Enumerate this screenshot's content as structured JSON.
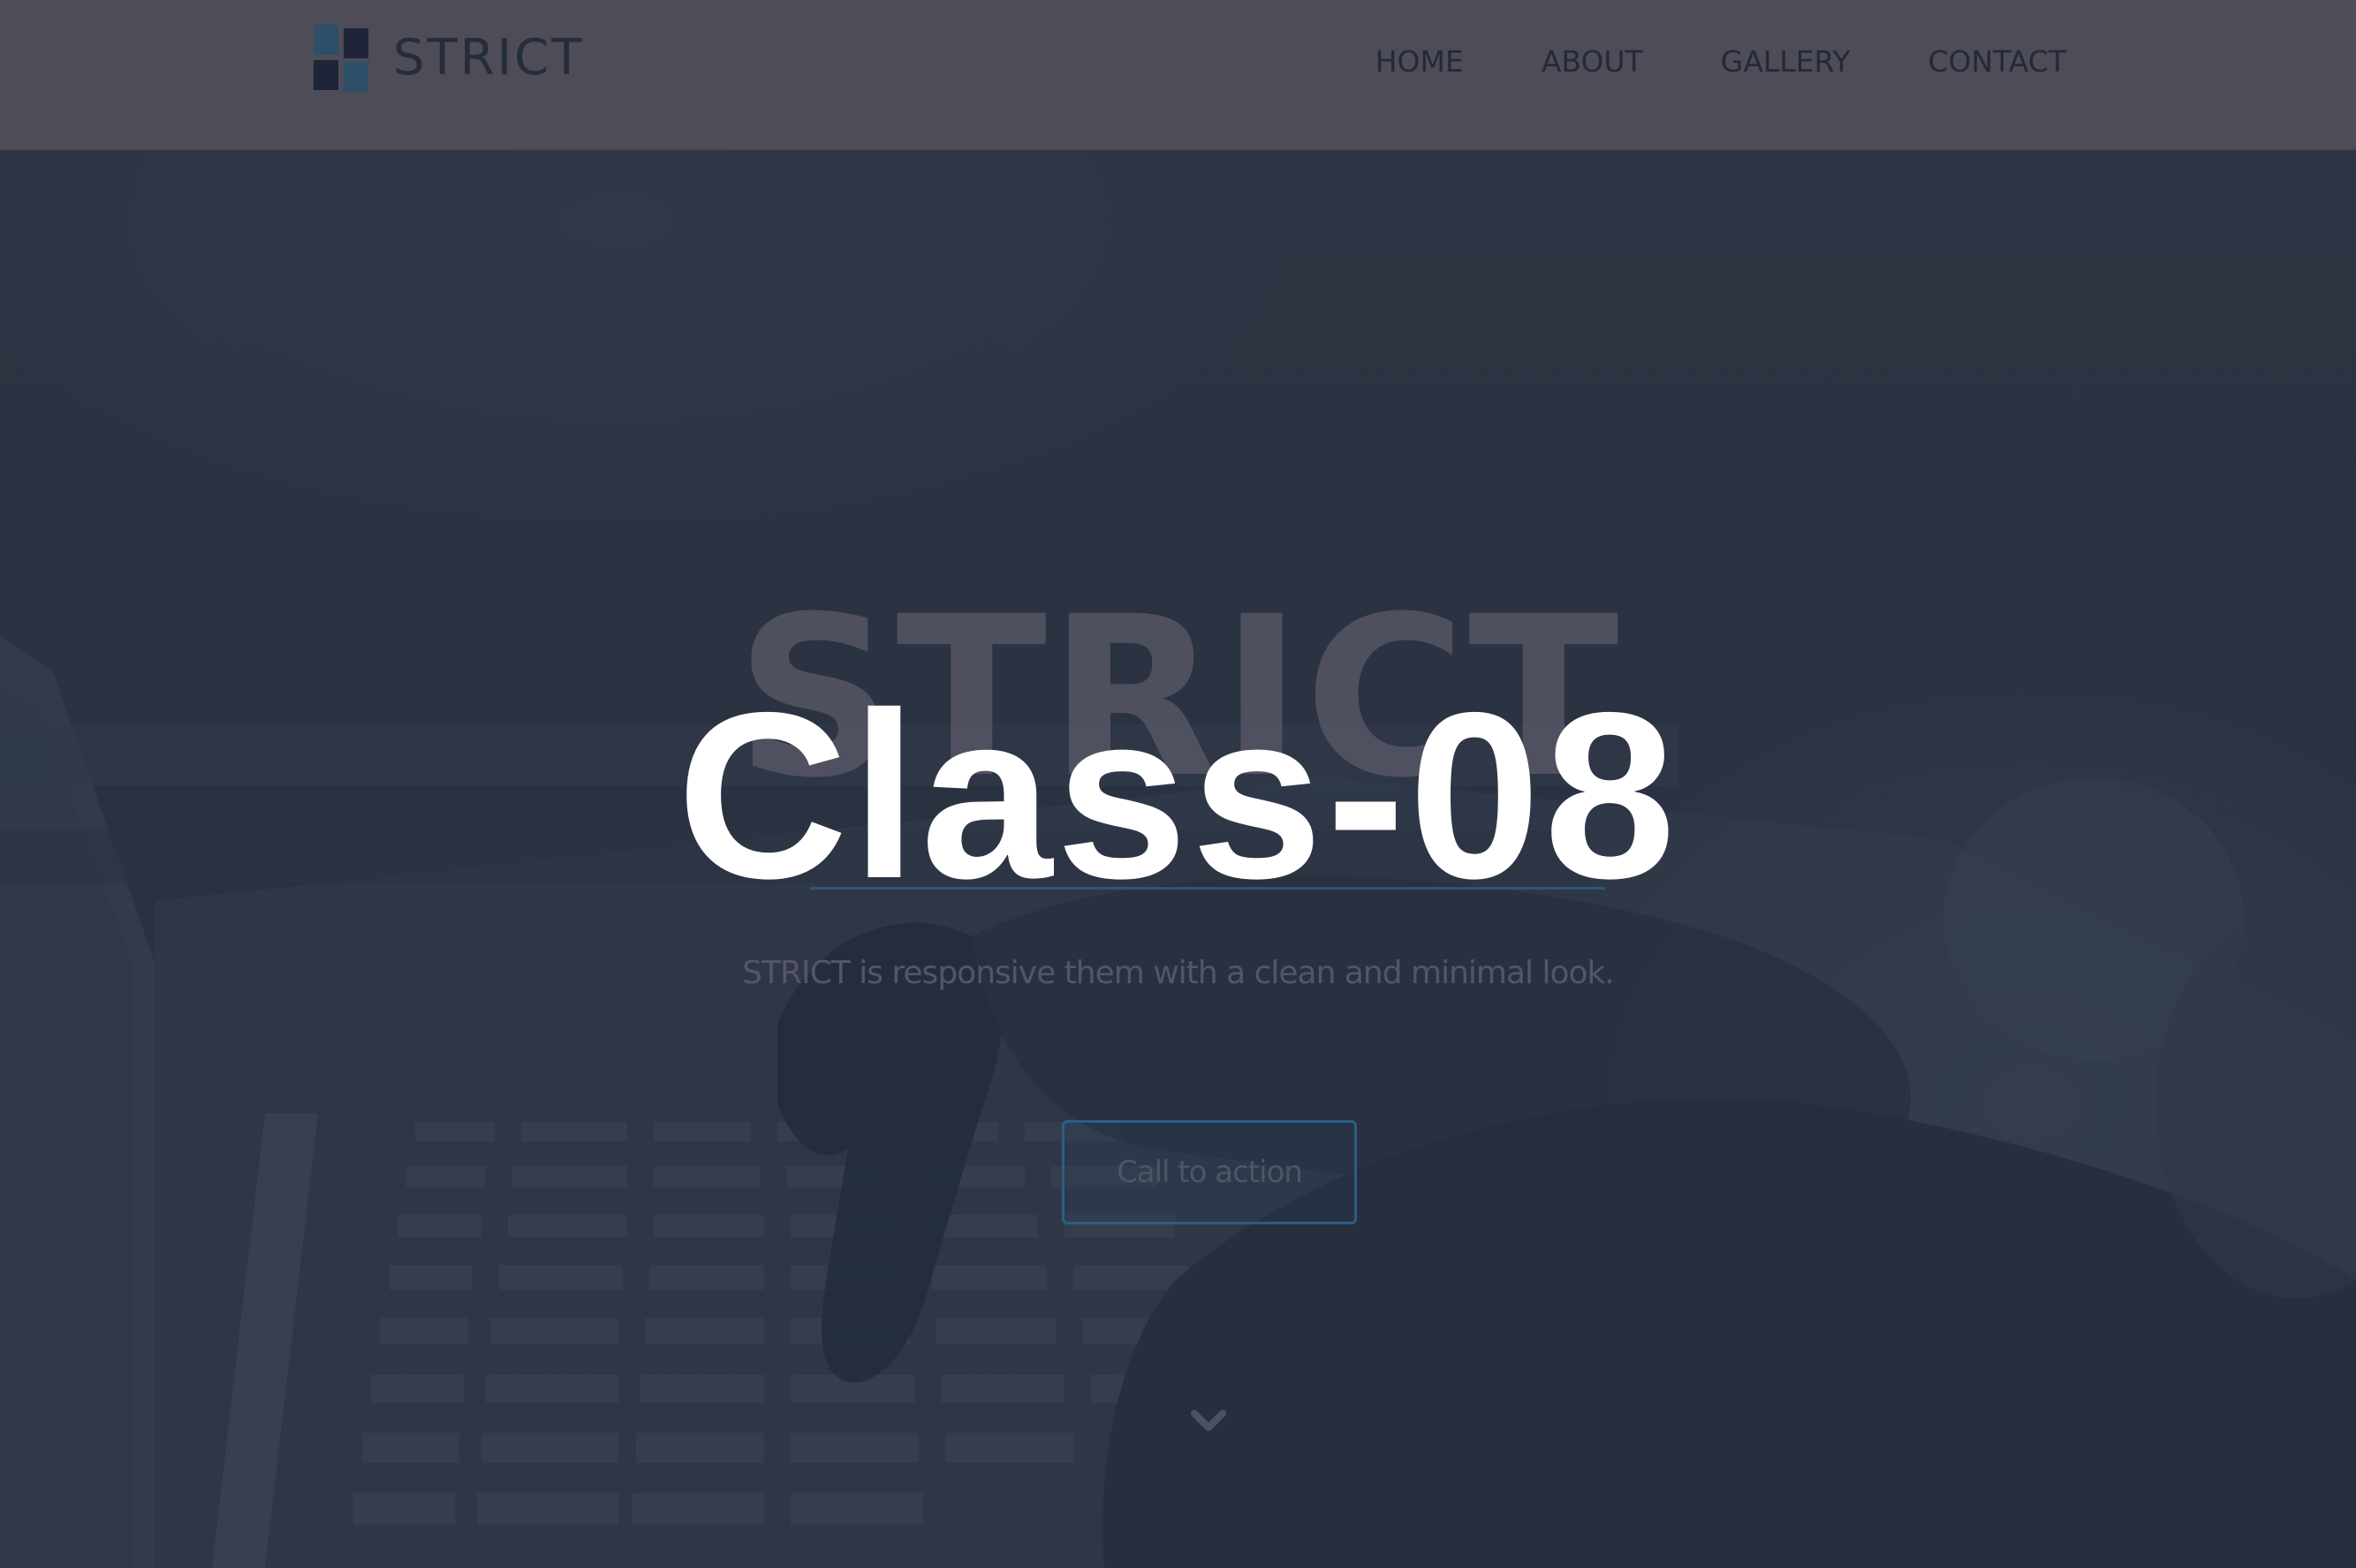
{
  "header": {
    "logo_text": "STRICT",
    "nav": [
      {
        "label": "HOME"
      },
      {
        "label": "ABOUT"
      },
      {
        "label": "GALLERY"
      },
      {
        "label": "CONTACT"
      }
    ]
  },
  "hero": {
    "title": "STRICT",
    "tagline": "STRICT is responsive them with a clean and minimal look.",
    "cta_label": "Call to action",
    "scroll_icon": "chevron-down-icon"
  },
  "overlay": {
    "label": "Class-08"
  },
  "colors": {
    "header_bg": "#4d4c57",
    "hero_bg": "#2f3646",
    "accent": "#2a5f86",
    "overlay_text": "#ffffff"
  }
}
